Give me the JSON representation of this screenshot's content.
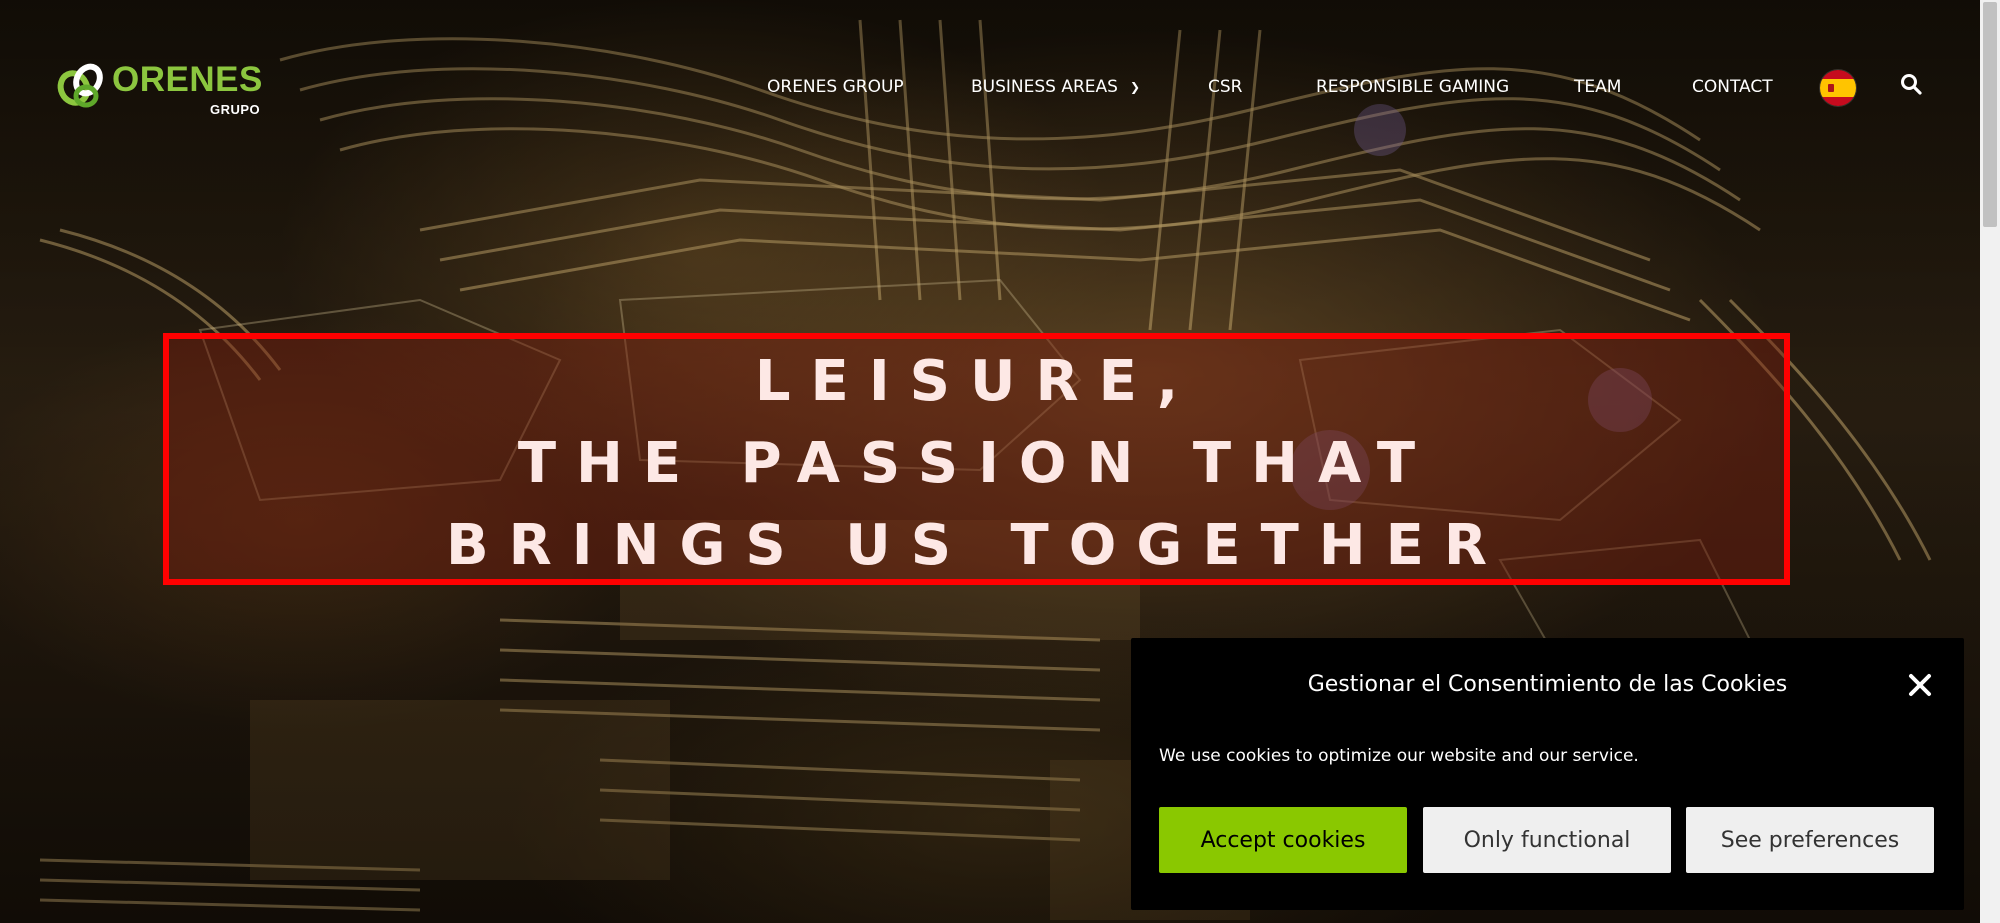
{
  "brand": {
    "name": "ORENES",
    "sub": "GRUPO",
    "green": "#8cc63f",
    "logo_icon": "interlocked-rings-logo-icon"
  },
  "nav": {
    "items": [
      {
        "label": "ORENES GROUP"
      },
      {
        "label": "BUSINESS AREAS",
        "has_dropdown": true
      },
      {
        "label": "CSR"
      },
      {
        "label": "RESPONSIBLE GAMING"
      },
      {
        "label": "TEAM"
      },
      {
        "label": "CONTACT"
      }
    ],
    "language_icon": "spain-flag-icon",
    "search_icon": "search-icon"
  },
  "hero": {
    "lines": [
      "LEISURE,",
      "THE PASSION THAT",
      "BRINGS US TOGETHER"
    ],
    "border_color": "#ff0000"
  },
  "cookie": {
    "title": "Gestionar el Consentimiento de las Cookies",
    "text": "We use cookies to optimize our website and our service.",
    "accept_label": "Accept cookies",
    "functional_label": "Only functional",
    "preferences_label": "See preferences",
    "accept_color": "#8ac800",
    "close_icon": "close-icon"
  }
}
